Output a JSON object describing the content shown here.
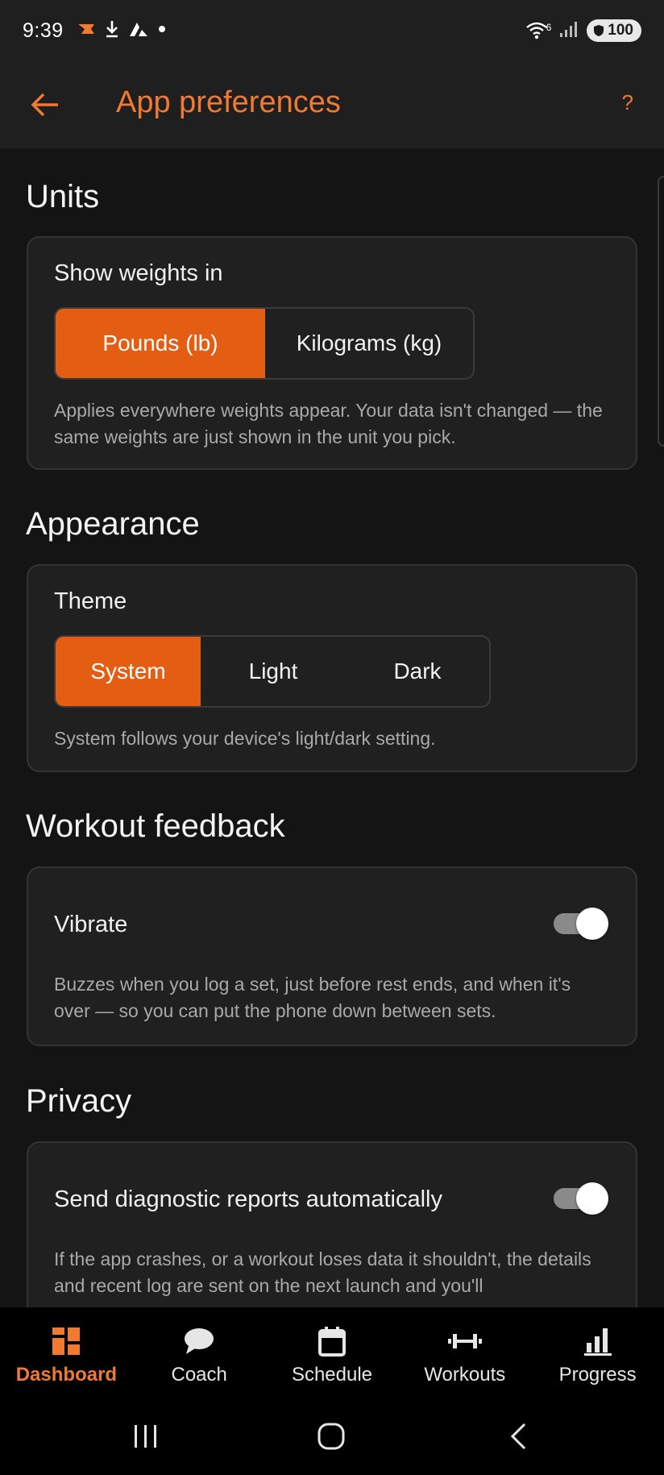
{
  "status_bar": {
    "time": "9:39",
    "battery": "100",
    "icons": [
      "app-notification-icon",
      "download-icon",
      "app-a-icon",
      "dot-icon",
      "wifi-icon",
      "signal-icon",
      "battery-icon"
    ],
    "wifi_badge": "6"
  },
  "app_bar": {
    "title": "App preferences",
    "help_label": "?",
    "back_icon": "arrow-left-icon"
  },
  "colors": {
    "accent": "#f07a32",
    "segment_active": "#e35d12",
    "background": "#141414",
    "card": "#202020"
  },
  "sections": {
    "units": {
      "title": "Units",
      "label": "Show weights in",
      "options": [
        "Pounds (lb)",
        "Kilograms (kg)"
      ],
      "selected": "Pounds (lb)",
      "description": "Applies everywhere weights appear. Your data isn't changed — the same weights are just shown in the unit you pick."
    },
    "appearance": {
      "title": "Appearance",
      "label": "Theme",
      "options": [
        "System",
        "Light",
        "Dark"
      ],
      "selected": "System",
      "description": "System follows your device's light/dark setting."
    },
    "workout_feedback": {
      "title": "Workout feedback",
      "label": "Vibrate",
      "toggle_on": true,
      "description": "Buzzes when you log a set, just before rest ends, and when it's over — so you can put the phone down between sets."
    },
    "privacy": {
      "title": "Privacy",
      "label": "Send diagnostic reports automatically",
      "toggle_on": true,
      "description": "If the app crashes, or a workout loses data it shouldn't, the details and recent log are sent on the next launch and you'll"
    }
  },
  "bottom_nav": {
    "items": [
      {
        "label": "Dashboard",
        "icon": "dashboard-icon",
        "active": true
      },
      {
        "label": "Coach",
        "icon": "chat-bubble-icon",
        "active": false
      },
      {
        "label": "Schedule",
        "icon": "calendar-icon",
        "active": false
      },
      {
        "label": "Workouts",
        "icon": "dumbbell-icon",
        "active": false
      },
      {
        "label": "Progress",
        "icon": "bar-chart-icon",
        "active": false
      }
    ]
  },
  "system_nav": {
    "buttons": [
      "recents-icon",
      "home-icon",
      "back-icon"
    ]
  }
}
